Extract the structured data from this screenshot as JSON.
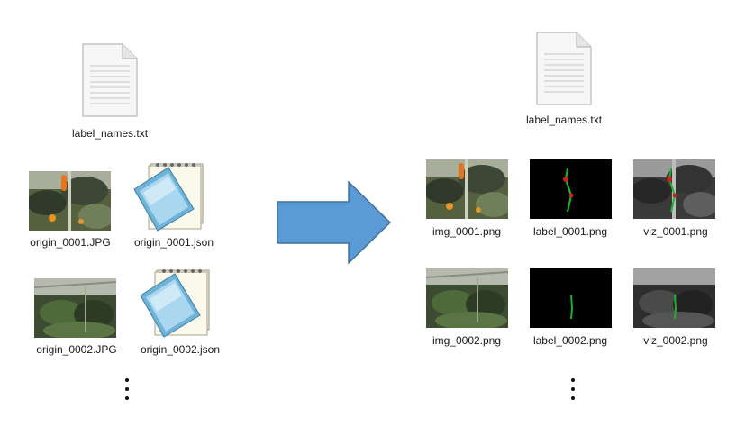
{
  "left": {
    "label_file": "label_names.txt",
    "rows": [
      {
        "image": "origin_0001.JPG",
        "json": "origin_0001.json"
      },
      {
        "image": "origin_0002.JPG",
        "json": "origin_0002.json"
      }
    ]
  },
  "arrow": {
    "color": "#5b9bd5",
    "icon": "right-arrow-icon"
  },
  "right": {
    "label_file": "label_names.txt",
    "rows": [
      {
        "img": "img_0001.png",
        "label": "label_0001.png",
        "viz": "viz_0001.png"
      },
      {
        "img": "img_0002.png",
        "label": "label_0002.png",
        "viz": "viz_0002.png"
      }
    ]
  },
  "more_indicator": {
    "icon": "vertical-ellipsis-icon"
  }
}
